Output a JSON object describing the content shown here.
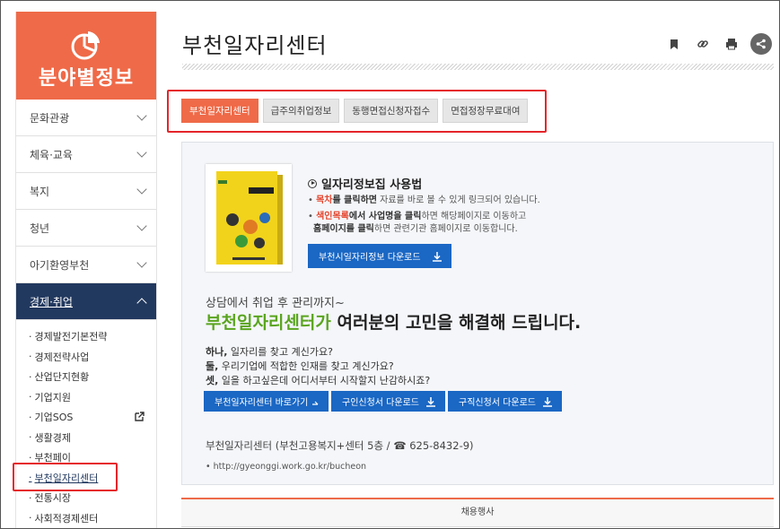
{
  "sidebar": {
    "title": "분야별정보",
    "menu": [
      "문화관광",
      "체육·교육",
      "복지",
      "청년",
      "아기환영부천"
    ],
    "active": "경제·취업",
    "sub": [
      "경제발전기본전략",
      "경제전략사업",
      "산업단지현황",
      "기업지원",
      "기업SOS",
      "생활경제",
      "부천페이",
      "부천일자리센터",
      "전통시장",
      "사회적경제센터"
    ]
  },
  "main": {
    "title": "부천일자리센터",
    "tabs": [
      "부천일자리센터",
      "급주의취업정보",
      "동행면접신청자접수",
      "면접정장무료대여"
    ],
    "usage_title": "일자리정보집 사용법",
    "usage1_a": "목차",
    "usage1_b": "를 클릭하면",
    "usage1_c": " 자료를 바로 볼 수 있게 링크되어 있습니다.",
    "usage2_a": "색인목록",
    "usage2_b": "에서 사업명을 클릭",
    "usage2_c": "하면 해당페이지로 이동하고",
    "usage3_a": "홈페이지를 클릭",
    "usage3_b": "하면 관련기관 홈페이지로 이동합니다.",
    "download_info": "부천시일자리정보 다운로드",
    "lead": "상담에서 취업 후 관리까지~",
    "headline_green": "부천일자리센터가",
    "headline_rest": " 여러분의 고민을 해결해 드립니다.",
    "q1_b": "하나,",
    "q1": " 일자리를 찾고 계신가요?",
    "q2_b": "둘,",
    "q2": " 우리기업에 적합한 인재를 찾고 계신가요?",
    "q3_b": "셋,",
    "q3": " 일을 하고싶은데 어디서부터 시작할지 난감하시죠?",
    "btn_center": "부천일자리센터 바로가기",
    "btn_seek": "구인신청서 다운로드",
    "btn_job": "구직신청서 다운로드",
    "contact": "부천일자리센터 (부천고용복지+센터 5층 /",
    "phone": "625-8432-9)",
    "url": "http://gyeonggi.work.go.kr/bucheon",
    "events": "채용행사"
  }
}
